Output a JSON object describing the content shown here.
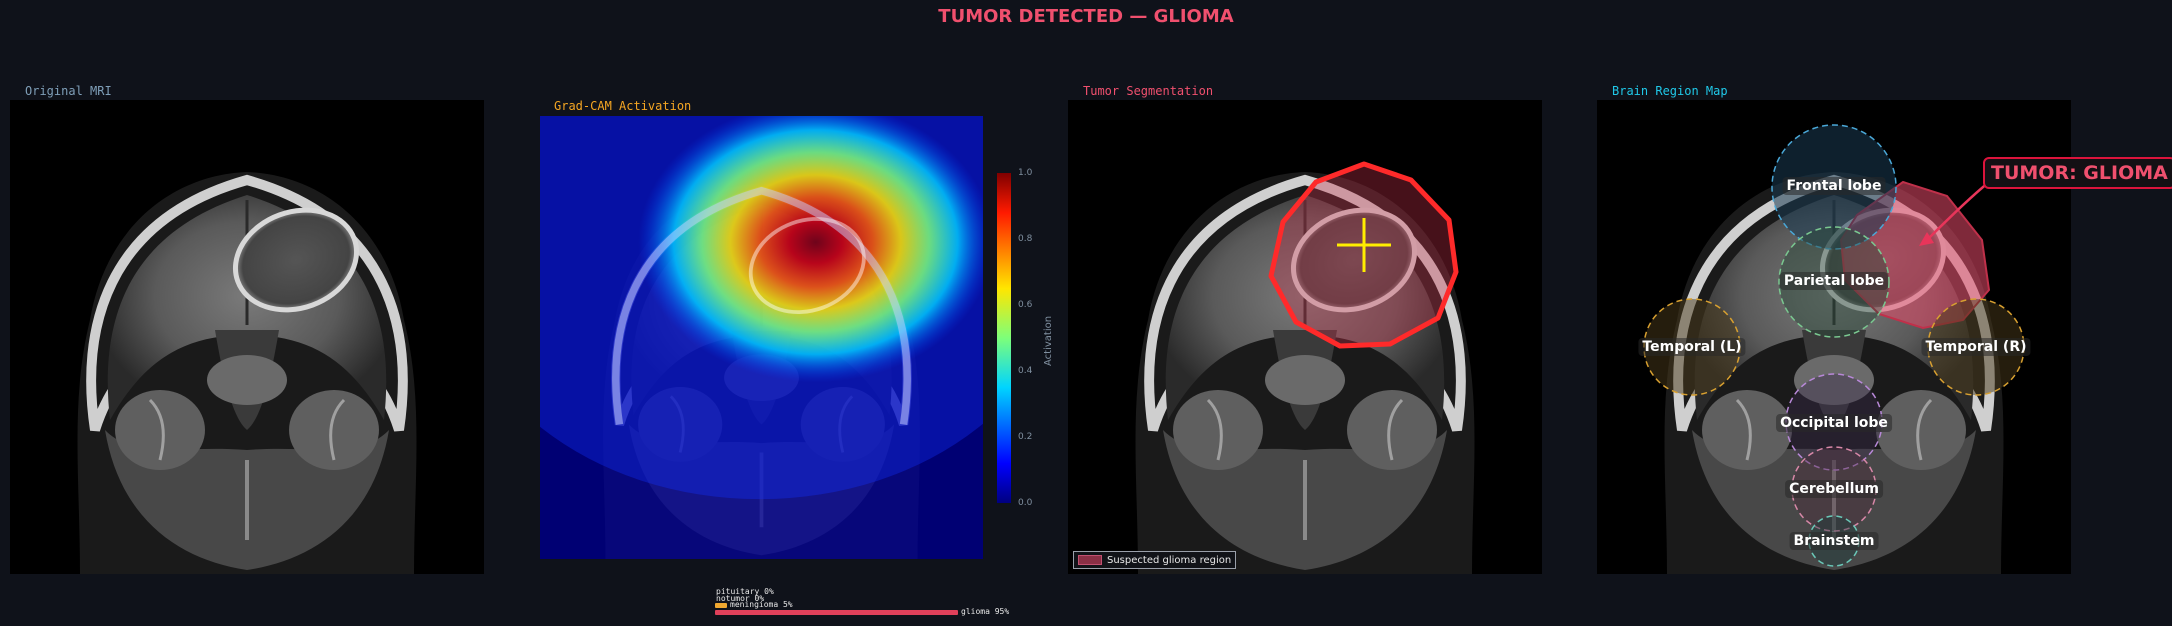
{
  "title": "TUMOR DETECTED — GLIOMA",
  "panels": {
    "original": {
      "title": "Original MRI"
    },
    "gradcam": {
      "title": "Grad-CAM Activation",
      "colorbar": {
        "label": "Activation",
        "ticks": [
          "1.0",
          "0.8",
          "0.6",
          "0.4",
          "0.2",
          "0.0"
        ]
      }
    },
    "segmentation": {
      "title": "Tumor Segmentation",
      "legend": "Suspected glioma region",
      "colors": {
        "outline": "#ff2a2a",
        "marker": "#ffee00"
      }
    },
    "regions": {
      "title": "Brain Region Map",
      "labels": [
        "Frontal lobe",
        "Parietal lobe",
        "Temporal (L)",
        "Temporal (R)",
        "Occipital lobe",
        "Cerebellum",
        "Brainstem"
      ],
      "tumor_label": "TUMOR: GLIOMA"
    }
  },
  "probabilities": [
    {
      "label": "pituitary 0%",
      "value": 0.0,
      "color": "#e8e8e8"
    },
    {
      "label": "notumor 0%",
      "value": 0.0,
      "color": "#e8e8e8"
    },
    {
      "label": "meningioma 5%",
      "value": 0.05,
      "color": "#f0a830"
    },
    {
      "label": "glioma 95%",
      "value": 0.95,
      "color": "#e0405a"
    }
  ],
  "colors": {
    "title": "#f0506e",
    "original_title": "#7f9fb8",
    "gradcam_title": "#f5a623",
    "segmentation_title": "#f0506e",
    "regions_title": "#20c8e8"
  }
}
